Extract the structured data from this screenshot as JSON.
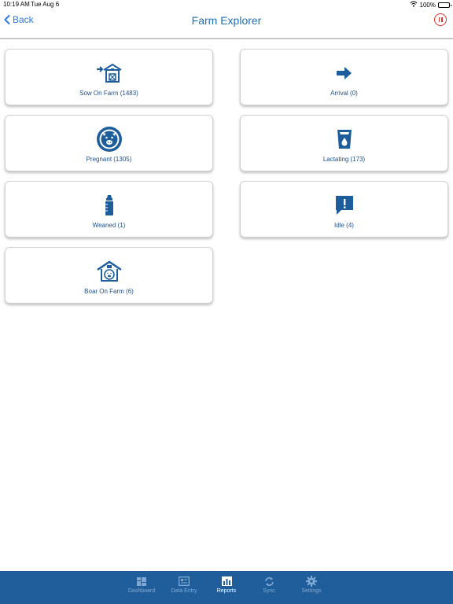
{
  "status": {
    "time": "10:19 AM",
    "date": "Tue Aug 6",
    "battery": "100%"
  },
  "nav": {
    "back_label": "Back",
    "title": "Farm Explorer"
  },
  "cards": [
    {
      "label": "Sow On Farm (1483)",
      "icon": "barn-arrow-icon"
    },
    {
      "label": "Arrival (0)",
      "icon": "arrow-right-icon"
    },
    {
      "label": "Pregnant (1305)",
      "icon": "pig-face-icon"
    },
    {
      "label": "Lactating (173)",
      "icon": "milk-glass-icon"
    },
    {
      "label": "Weaned (1)",
      "icon": "baby-bottle-icon"
    },
    {
      "label": "Idle (4)",
      "icon": "alert-bubble-icon"
    },
    {
      "label": "Boar On Farm (6)",
      "icon": "barn-pig-icon"
    }
  ],
  "tabs": [
    {
      "label": "Dashboard",
      "icon": "dashboard-icon"
    },
    {
      "label": "Data Entry",
      "icon": "data-entry-icon"
    },
    {
      "label": "Reports",
      "icon": "reports-icon",
      "active": true
    },
    {
      "label": "Sync",
      "icon": "sync-icon"
    },
    {
      "label": "Settings",
      "icon": "settings-icon"
    }
  ],
  "colors": {
    "accent": "#1d6fb3",
    "tab_bar": "#1f5e9a",
    "alert": "#e0342b"
  }
}
